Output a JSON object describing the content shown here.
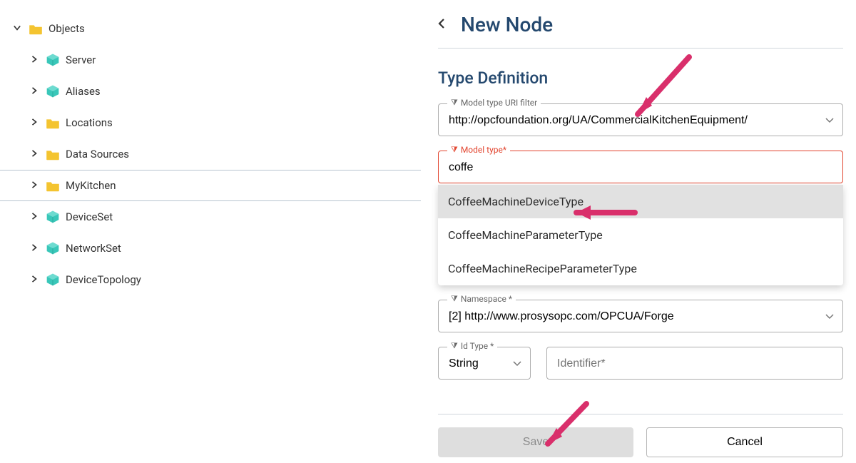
{
  "tree": {
    "root_label": "Objects",
    "items": [
      {
        "label": "Server",
        "icon": "cube",
        "selected": false
      },
      {
        "label": "Aliases",
        "icon": "cube",
        "selected": false
      },
      {
        "label": "Locations",
        "icon": "folder",
        "selected": false
      },
      {
        "label": "Data Sources",
        "icon": "folder",
        "selected": false
      },
      {
        "label": "MyKitchen",
        "icon": "folder",
        "selected": true
      },
      {
        "label": "DeviceSet",
        "icon": "cube",
        "selected": false
      },
      {
        "label": "NetworkSet",
        "icon": "cube",
        "selected": false
      },
      {
        "label": "DeviceTopology",
        "icon": "cube",
        "selected": false
      }
    ]
  },
  "panel": {
    "title": "New Node",
    "section_title": "Type Definition",
    "uri_filter": {
      "label": "Model type URI filter",
      "value": "http://opcfoundation.org/UA/CommercialKitchenEquipment/"
    },
    "model_type": {
      "label": "Model type*",
      "value": "coffe",
      "suggestions": [
        "CoffeeMachineDeviceType",
        "CoffeeMachineParameterType",
        "CoffeeMachineRecipeParameterType"
      ]
    },
    "namespace": {
      "label": "Namespace *",
      "value": "[2] http://www.prosysopc.com/OPCUA/Forge"
    },
    "id_type": {
      "label": "Id Type *",
      "value": "String"
    },
    "identifier": {
      "placeholder": "Identifier*",
      "value": ""
    },
    "save_label": "Save",
    "cancel_label": "Cancel"
  }
}
